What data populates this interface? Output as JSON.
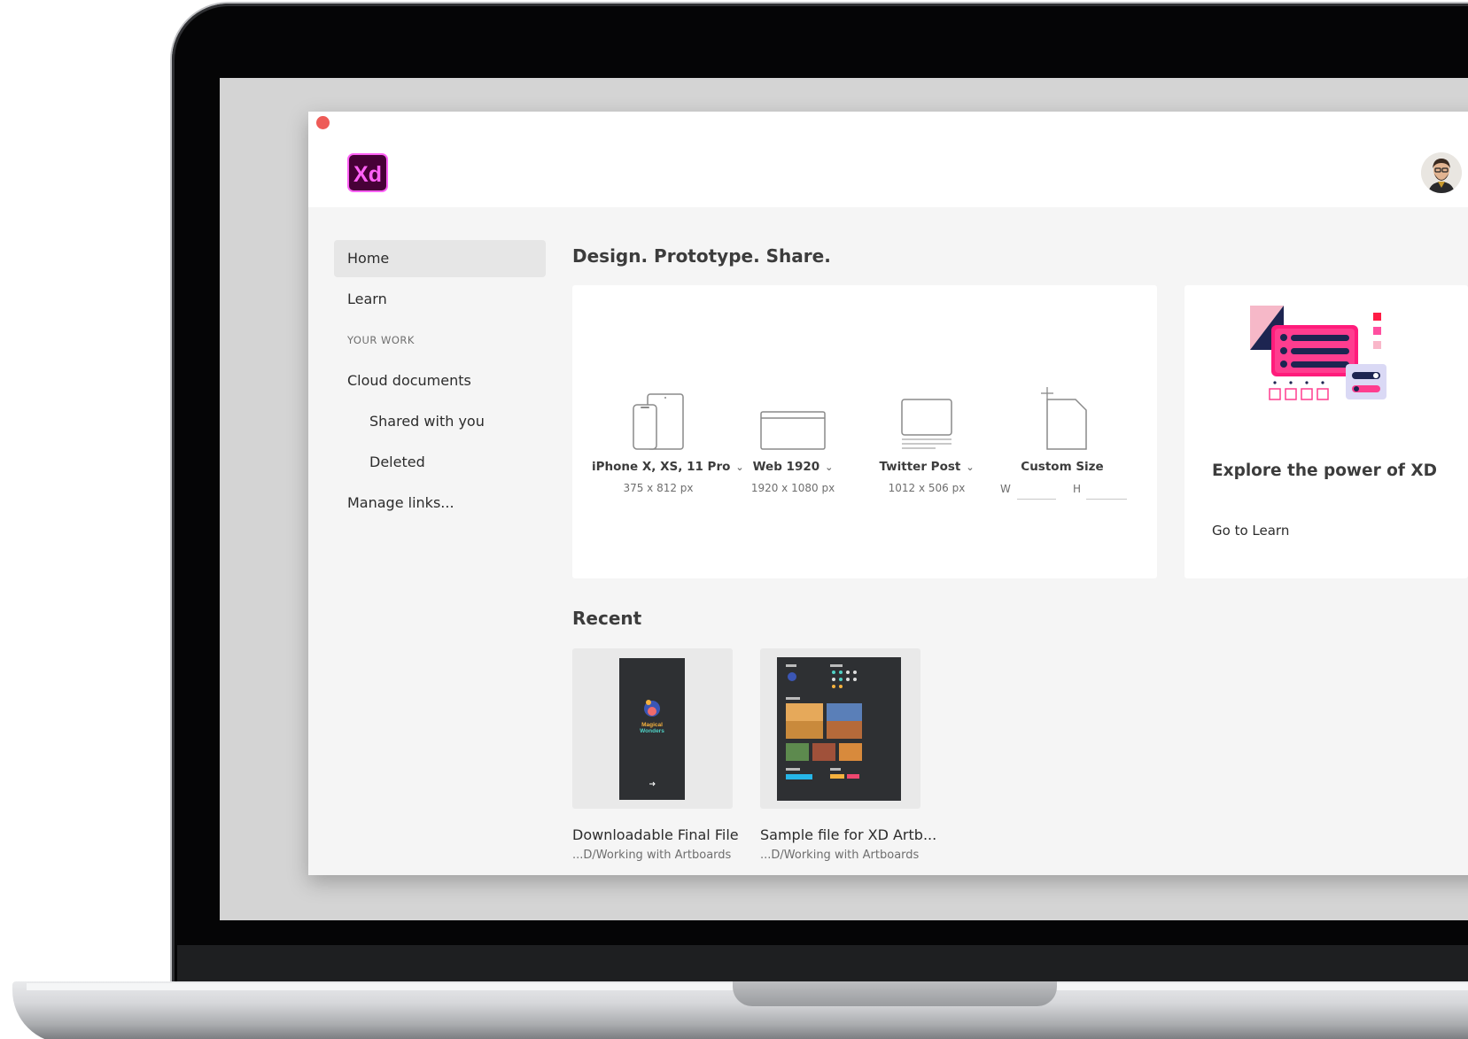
{
  "app": {
    "logo_text": "Xd",
    "brand_colors": {
      "logo_bg": "#470137",
      "logo_fg": "#ff61f6",
      "close_dot": "#ee5b57"
    }
  },
  "sidebar": {
    "items": [
      {
        "label": "Home",
        "active": true
      },
      {
        "label": "Learn"
      }
    ],
    "section_header": "YOUR WORK",
    "work_items": [
      {
        "label": "Cloud documents"
      },
      {
        "label": "Shared with you",
        "indent": true
      },
      {
        "label": "Deleted",
        "indent": true
      },
      {
        "label": "Manage links..."
      }
    ]
  },
  "main": {
    "title": "Design. Prototype. Share.",
    "presets": [
      {
        "name": "iPhone X, XS, 11 Pro",
        "size": "375 x 812 px",
        "icon": "phone-tablet-icon",
        "has_dropdown": true
      },
      {
        "name": "Web 1920",
        "size": "1920 x 1080 px",
        "icon": "browser-window-icon",
        "has_dropdown": true
      },
      {
        "name": "Twitter Post",
        "size": "1012 x 506 px",
        "icon": "social-post-icon",
        "has_dropdown": true
      },
      {
        "name": "Custom Size",
        "icon": "custom-page-icon",
        "w_label": "W",
        "h_label": "H"
      }
    ],
    "learn_card": {
      "title": "Explore the power of XD",
      "link": "Go to Learn",
      "illustration": "xd-ui-illustration"
    },
    "recent_title": "Recent",
    "recent": [
      {
        "name": "Downloadable Final File",
        "path": "...D/Working with Artboards",
        "thumb_text": "Magical Wonders"
      },
      {
        "name": "Sample file for XD Artb...",
        "path": "...D/Working with Artboards"
      }
    ]
  }
}
